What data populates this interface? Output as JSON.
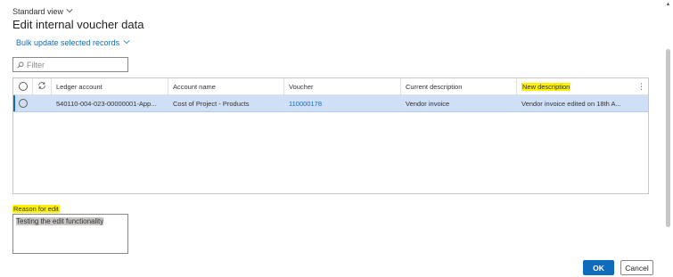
{
  "view": {
    "label": "Standard view"
  },
  "page": {
    "title": "Edit internal voucher data"
  },
  "bulk": {
    "label": "Bulk update selected records"
  },
  "filter": {
    "placeholder": "Filter"
  },
  "grid": {
    "columns": {
      "ledger_account": "Ledger account",
      "account_name": "Account name",
      "voucher": "Voucher",
      "current_description": "Current description",
      "new_description": "New description"
    },
    "rows": [
      {
        "ledger_account": "540110-004-023-00000001-App...",
        "account_name": "Cost of Project  - Products",
        "voucher": "110000178",
        "current_description": "Vendor invoice",
        "new_description": "Vendor invoice edited on 18th A..."
      }
    ]
  },
  "reason": {
    "label": "Reason for edit",
    "value": "Testing the edit functionality"
  },
  "buttons": {
    "ok": "OK",
    "cancel": "Cancel"
  },
  "colors": {
    "accent": "#0f6cbd",
    "highlight": "#fff200",
    "selected_row": "#cfe0f6"
  }
}
